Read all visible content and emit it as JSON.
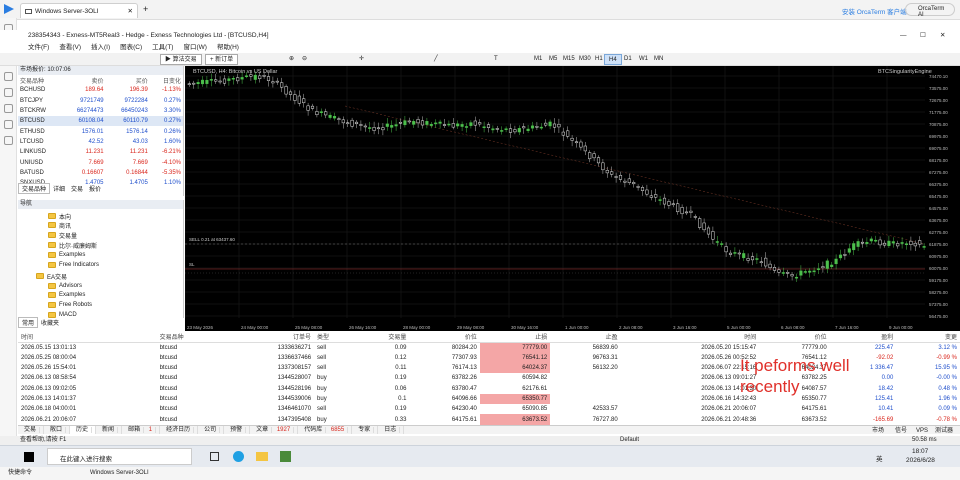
{
  "os_tab": {
    "title": "Windows Server-3OLI",
    "close": "✕",
    "add": "+"
  },
  "topright": {
    "link": "安装 OrcaTerm 客户端",
    "ai": "OrcaTerm AI"
  },
  "window_title": "238354343 - Exness-MT5Real3 - Hedge - Exness Technologies Ltd - [BTCUSD,H4]",
  "menu": [
    "文件(F)",
    "查看(V)",
    "插入(I)",
    "图表(C)",
    "工具(T)",
    "窗口(W)",
    "帮助(H)"
  ],
  "toolbar": {
    "algo": "算法交易",
    "new_order": "新订单",
    "timeframes": [
      "M1",
      "M5",
      "M15",
      "M30",
      "H1",
      "H4",
      "D1",
      "W1",
      "MN"
    ],
    "active_tf": "H4"
  },
  "market_watch": {
    "title": "市场报价: 10:07:06",
    "headers": [
      "交易品种",
      "卖价",
      "买价",
      "日变化"
    ],
    "rows": [
      {
        "symbol": "BCHUSD",
        "bid": "189.64",
        "ask": "196.39",
        "change": "-1.13%"
      },
      {
        "symbol": "BTCJPY",
        "bid": "9721749",
        "ask": "9722284",
        "change": "0.27%"
      },
      {
        "symbol": "BTCKRW",
        "bid": "66274473",
        "ask": "66450243",
        "change": "3.30%"
      },
      {
        "symbol": "BTCUSD",
        "bid": "60108.04",
        "ask": "60110.79",
        "change": "0.27%"
      },
      {
        "symbol": "ETHUSD",
        "bid": "1576.01",
        "ask": "1576.14",
        "change": "0.26%"
      },
      {
        "symbol": "LTCUSD",
        "bid": "42.52",
        "ask": "43.03",
        "change": "1.60%"
      },
      {
        "symbol": "LINKUSD",
        "bid": "11.231",
        "ask": "11.231",
        "change": "-6.21%"
      },
      {
        "symbol": "UNIUSD",
        "bid": "7.669",
        "ask": "7.669",
        "change": "-4.10%"
      },
      {
        "symbol": "BATUSD",
        "bid": "0.16607",
        "ask": "0.16844",
        "change": "-5.35%"
      },
      {
        "symbol": "SNXUSD",
        "bid": "1.4705",
        "ask": "1.4705",
        "change": "1.10%"
      }
    ],
    "tabs": [
      "交易品种",
      "详细",
      "交易",
      "报价"
    ]
  },
  "navigator": {
    "title": "导航",
    "items": [
      "本向",
      "商讯",
      "交易量",
      "比尔·威廉姆斯",
      "Examples",
      "Free Indicators",
      "EA交易",
      "Advisors",
      "Examples",
      "Free Robots",
      "MACD",
      "Moving Average"
    ],
    "tabs": [
      "常用",
      "收藏夹"
    ]
  },
  "chart": {
    "symbol_label": "BTCUSD, H4: Bitcoin vs US Dollar",
    "ea_label": "BTCSingularityEngine",
    "sell_label": "SELL 0.21 at 63437.60",
    "level_label": "SL",
    "price_labels": [
      "74470.10",
      "73575.00",
      "72675.00",
      "71775.00",
      "70875.00",
      "69975.00",
      "69075.00",
      "68175.00",
      "67275.00",
      "66375.00",
      "65475.00",
      "64575.00",
      "63675.00",
      "62775.00",
      "61875.00",
      "60975.00",
      "60075.00",
      "59175.00",
      "58275.00",
      "57375.00",
      "56475.00"
    ],
    "time_labels": [
      "23 May 2026",
      "24 May 00:00",
      "25 May 08:00",
      "26 May 16:00",
      "28 May 00:00",
      "29 May 08:00",
      "30 May 16:00",
      "1 Jun 00:00",
      "2 Jun 08:00",
      "3 Jun 16:00",
      "5 Jun 00:00",
      "6 Jun 08:00",
      "7 Jun 16:00",
      "9 Jun 00:00"
    ]
  },
  "trades": {
    "headers": [
      "时间",
      "交易品种",
      "订单号",
      "类型",
      "交易量",
      "价位",
      "止损",
      "止盈",
      "时间",
      "价位",
      "盈利",
      "变更"
    ],
    "rows": [
      {
        "time": "2026.05.15 13:01:13",
        "symbol": "btcusd",
        "ticket": "1333636271",
        "type": "sell",
        "volume": "0.09",
        "open": "80284.20",
        "sl": "77779.00",
        "tp": "56839.60",
        "ctime": "2026.05.20 15:15:47",
        "close": "77779.00",
        "profit": "225.47",
        "change": "3.12 %",
        "sl_pink": true
      },
      {
        "time": "2026.05.25 08:00:04",
        "symbol": "btcusd",
        "ticket": "1336637466",
        "type": "sell",
        "volume": "0.12",
        "open": "77307.93",
        "sl": "76541.12",
        "tp": "96763.31",
        "ctime": "2026.05.26 00:52:52",
        "close": "76541.12",
        "profit": "-92.02",
        "change": "-0.99 %",
        "sl_pink": true
      },
      {
        "time": "2026.05.26 15:54:01",
        "symbol": "btcusd",
        "ticket": "1337308157",
        "type": "sell",
        "volume": "0.11",
        "open": "76174.13",
        "sl": "64024.37",
        "tp": "56132.20",
        "ctime": "2026.06.07 22:15:16",
        "close": "64024.37",
        "profit": "1 336.47",
        "change": "15.95 %",
        "sl_pink": true
      },
      {
        "time": "2026.06.13 08:58:54",
        "symbol": "btcusd",
        "ticket": "1344528007",
        "type": "buy",
        "volume": "0.19",
        "open": "63782.26",
        "sl": "60594.82",
        "tp": "",
        "ctime": "2026.06.13 09:01:27",
        "close": "63782.25",
        "profit": "0.00",
        "change": "-0.00 %",
        "sl_pink": false
      },
      {
        "time": "2026.06.13 09:02:05",
        "symbol": "btcusd",
        "ticket": "1344528196",
        "type": "buy",
        "volume": "0.06",
        "open": "63780.47",
        "sl": "62176.61",
        "tp": "",
        "ctime": "2026.06.13 14:01:30",
        "close": "64087.57",
        "profit": "18.42",
        "change": "0.48 %",
        "sl_pink": false
      },
      {
        "time": "2026.06.13 14:01:37",
        "symbol": "btcusd",
        "ticket": "1344539006",
        "type": "buy",
        "volume": "0.1",
        "open": "64096.66",
        "sl": "65350.77",
        "tp": "",
        "ctime": "2026.06.16 14:32:43",
        "close": "65350.77",
        "profit": "125.41",
        "change": "1.96 %",
        "sl_pink": true
      },
      {
        "time": "2026.06.18 04:00:01",
        "symbol": "btcusd",
        "ticket": "1346461070",
        "type": "sell",
        "volume": "0.19",
        "open": "64230.40",
        "sl": "65090.85",
        "tp": "42533.57",
        "ctime": "2026.06.21 20:06:07",
        "close": "64175.61",
        "profit": "10.41",
        "change": "0.09 %",
        "sl_pink": false
      },
      {
        "time": "2026.06.21 20:06:07",
        "symbol": "btcusd",
        "ticket": "1347395408",
        "type": "buy",
        "volume": "0.33",
        "open": "64175.61",
        "sl": "63673.52",
        "tp": "76727.80",
        "ctime": "2026.06.21 20:48:36",
        "close": "63673.52",
        "profit": "-165.69",
        "change": "-0.78 %",
        "sl_pink": true
      }
    ]
  },
  "bottom_tabs": [
    "交易",
    "敞口",
    "历史",
    "新闻",
    "邮箱",
    "经济日历",
    "公司",
    "预警",
    "文章",
    "代码库",
    "专家",
    "日志"
  ],
  "bottom_tab_badges": {
    "邮箱": "1",
    "文章": "1927",
    "代码库": "6855"
  },
  "annotation": [
    "It peforms well",
    "recently"
  ],
  "status": {
    "help": "查看帮助,请按 F1",
    "profile": "Default",
    "market": "市场",
    "signal": "信号",
    "vps": "VPS",
    "tester": "测试器",
    "ping": "50.58 ms"
  },
  "taskbar": {
    "search": "在此键入进行搜索",
    "app_label": "Windows Server-3OLI",
    "time": "18:07",
    "date": "2026/6/28",
    "lang": "英",
    "quick": "快捷命令"
  },
  "colors": {
    "bull": "#4cbf4c",
    "bear": "#e6e6e6",
    "pink": "#f4a6a6",
    "neg": "#d9261c",
    "pos": "#1f4fcc"
  }
}
